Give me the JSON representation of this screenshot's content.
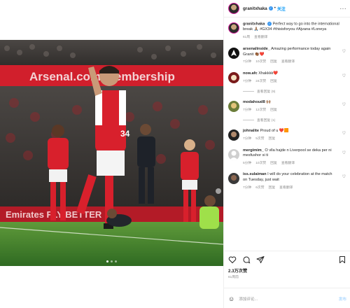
{
  "header": {
    "username": "granitxhaka",
    "separator": "•",
    "follow_label": "关注",
    "more": "···"
  },
  "media": {
    "banner_text": "Arsenal.com/membership",
    "board_text": "Emirates FLY BETTER",
    "shirt_number": "34",
    "carousel_dots": 3,
    "active_dot": 1
  },
  "caption": {
    "username": "granitxhaka",
    "text": "Perfect way to go into the international break 🙏🏽 #GX34 #thisisforyou #Ajvana #Loneya",
    "time": "61周"
  },
  "view_translation": "查看翻译",
  "comments": [
    {
      "username": "arsenalinside_",
      "text": "Amazing performance today again Granit 👏🏾❤️",
      "time": "7分钟",
      "likes": "10次赞",
      "reply": "回复",
      "translate": "查看翻译",
      "avatar_color": "#111111"
    },
    {
      "username": "now.afc",
      "text": "Xhakkkk❤️",
      "time": "7分钟",
      "likes": "24次赞",
      "reply": "回复",
      "translate": "",
      "avatar_color": "#7a1b1b",
      "replies": "查看回复 (9)"
    },
    {
      "username": "modahoud8",
      "text": "🙌🏽",
      "time": "7分钟",
      "likes": "12次赞",
      "reply": "回复",
      "translate": "",
      "avatar_color": "#6b7d3a",
      "replies": "查看回复 (1)"
    },
    {
      "username": "johnalite",
      "text": "Proud of u ❤️🟧",
      "time": "7分钟",
      "likes": "5次赞",
      "reply": "回复",
      "translate": "",
      "avatar_color": "#222222"
    },
    {
      "username": "mergimim_",
      "text": "O vlla hajde n Liverpool se deka per ni mesfushor si ti",
      "time": "5分钟",
      "likes": "10次赞",
      "reply": "回复",
      "translate": "查看翻译",
      "avatar_color": "#cfcfcf"
    },
    {
      "username": "iss.sulaiman",
      "text": "I will do your celebration at the match on Tuesday, just wait",
      "time": "7分钟",
      "likes": "6次赞",
      "reply": "回复",
      "translate": "查看翻译",
      "avatar_color": "#3a3a3a"
    }
  ],
  "actions": {
    "likes_count": "2.3万次赞",
    "date": "61周前"
  },
  "add_comment": {
    "placeholder": "添加评论...",
    "post_label": "发布"
  }
}
